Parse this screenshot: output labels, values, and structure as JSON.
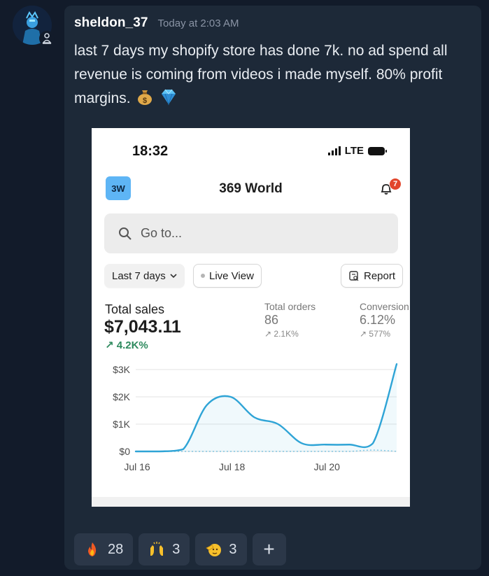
{
  "author": {
    "username": "sheldon_37",
    "timestamp": "Today at 2:03 AM"
  },
  "message": {
    "text": "last 7 days my shopify store has done 7k. no ad spend all revenue is coming from videos i made myself. 80% profit margins.",
    "emojis": [
      "money-bag-icon",
      "gem-icon"
    ]
  },
  "screenshot": {
    "status_bar": {
      "time": "18:32",
      "network": "LTE"
    },
    "store_badge": "3W",
    "store_name": "369 World",
    "notification_count": "7",
    "search_placeholder": "Go to...",
    "filters": {
      "date_range": "Last 7 days",
      "live_view": "Live View",
      "report": "Report"
    },
    "metrics": {
      "total_sales": {
        "label": "Total sales",
        "value": "$7,043.11",
        "change": "4.2K%"
      },
      "total_orders": {
        "label": "Total orders",
        "value": "86",
        "change": "2.1K%"
      },
      "conversion": {
        "label": "Conversion",
        "value": "6.12%",
        "change": "577%"
      }
    },
    "accent_color": "#2fa4d6",
    "positive_color": "#2e8a5e"
  },
  "chart_data": {
    "type": "line",
    "x": [
      "Jul 16",
      "Jul 16.5",
      "Jul 17",
      "Jul 17.5",
      "Jul 18",
      "Jul 18.5",
      "Jul 19",
      "Jul 19.5",
      "Jul 20",
      "Jul 20.5",
      "Jul 21",
      "Jul 21.5"
    ],
    "x_tick_labels": [
      "Jul 16",
      "Jul 18",
      "Jul 20"
    ],
    "y_tick_labels": [
      "$3K",
      "$2K",
      "$1K",
      "$0"
    ],
    "ylim": [
      0,
      3000
    ],
    "series": [
      {
        "values": [
          0,
          0,
          80,
          1700,
          2000,
          1250,
          1000,
          300,
          250,
          250,
          300,
          3200
        ]
      },
      {
        "values": [
          0,
          0,
          0,
          0,
          0,
          0,
          0,
          0,
          0,
          0,
          50,
          0
        ]
      }
    ],
    "grid": true
  },
  "reactions": [
    {
      "icon": "fire-icon",
      "count": "28"
    },
    {
      "icon": "raised-hands-icon",
      "count": "3"
    },
    {
      "icon": "saluting-face-icon",
      "count": "3"
    }
  ],
  "add_reaction_label": "+"
}
